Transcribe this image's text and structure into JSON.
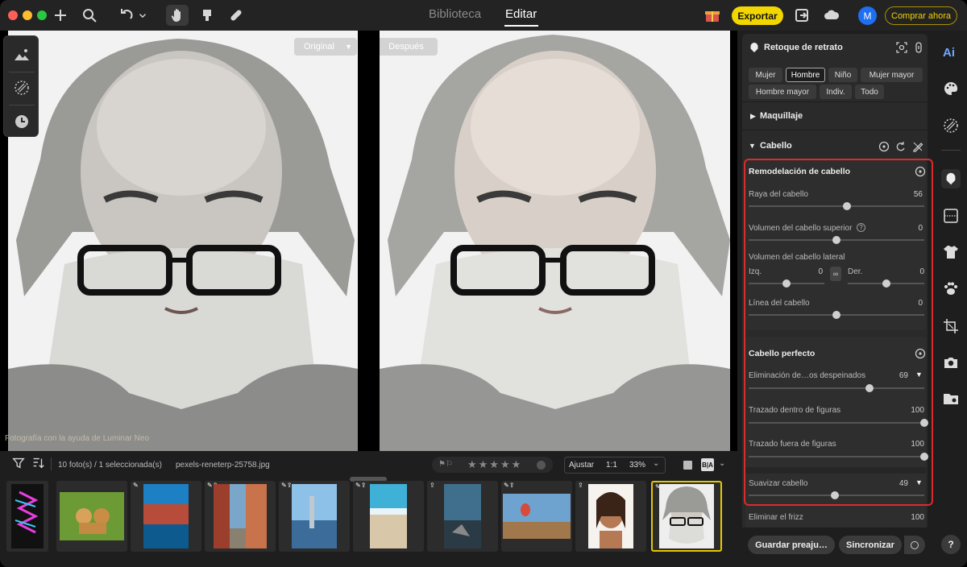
{
  "window": {
    "tabs": [
      "Biblioteca",
      "Editar"
    ],
    "active_tab": "Editar"
  },
  "toolbar": {
    "export_label": "Exportar",
    "buy_label": "Comprar ahora",
    "avatar_letter": "M"
  },
  "viewer": {
    "before_label": "Original",
    "after_label": "Después",
    "watermark": "Fotografía con la ayuda de Luminar Neo"
  },
  "panel": {
    "title": "Retoque de retrato",
    "chips": [
      "Mujer",
      "Hombre",
      "Niño",
      "Mujer mayor",
      "Hombre mayor",
      "Indiv.",
      "Todo"
    ],
    "selected_chip": "Hombre",
    "makeup_label": "Maquillaje",
    "hair_label": "Cabello",
    "reshape": {
      "title": "Remodelación de cabello",
      "parting_label": "Raya del cabello",
      "parting_value": "56",
      "top_volume_label": "Volumen del cabello superior",
      "top_volume_value": "0",
      "side_volume_label": "Volumen del cabello lateral",
      "left_label": "Izq.",
      "left_value": "0",
      "right_label": "Der.",
      "right_value": "0",
      "hairline_label": "Línea del cabello",
      "hairline_value": "0"
    },
    "perfect": {
      "title": "Cabello perfecto",
      "flyaway_label": "Eliminación de…os despeinados",
      "flyaway_value": "69",
      "inside_label": "Trazado dentro de figuras",
      "inside_value": "100",
      "outside_label": "Trazado fuera de figuras",
      "outside_value": "100",
      "smooth_label": "Suavizar cabello",
      "smooth_value": "49",
      "frizz_label": "Eliminar el frizz",
      "frizz_value": "100"
    },
    "save_label": "Guardar preaju…",
    "sync_label": "Sincronizar"
  },
  "slider_levels": {
    "parting": 0.56,
    "top_volume": 0.5,
    "left": 0.5,
    "right": 0.5,
    "hairline": 0.5,
    "flyaway": 0.69,
    "inside": 1.0,
    "outside": 1.0,
    "smooth": 0.49
  },
  "filmbar": {
    "count_label": "10 foto(s) / 1 seleccionada(s)",
    "file_name": "pexels-reneterp-25758.jpg",
    "fit_label": "Ajustar",
    "ratio_label": "1:1",
    "zoom_label": "33%"
  },
  "colors": {
    "accent_yellow": "#f2d600",
    "highlight_red": "#d92c2c",
    "avatar_blue": "#1e6ff2"
  }
}
